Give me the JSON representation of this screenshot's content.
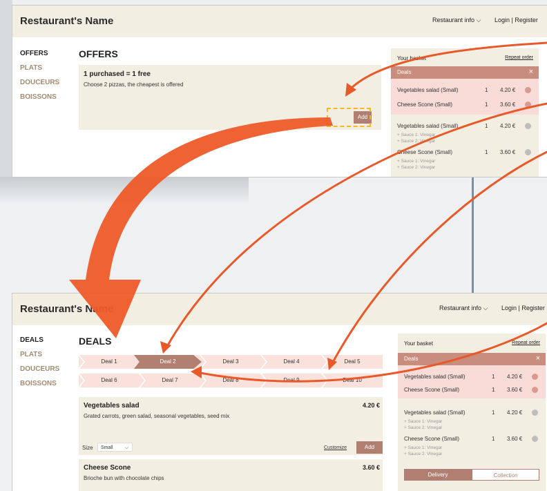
{
  "screens": {
    "offers": {
      "logo": "Restaurant's Name",
      "restaurant_info": "Restaurant info",
      "login": "Login | Register",
      "sidebar": [
        "OFFERS",
        "PLATS",
        "DOUCEURS",
        "BOISSONS"
      ],
      "page_title": "OFFERS",
      "offer": {
        "title": "1 purchased = 1 free",
        "desc": "Choose 2 pizzas, the cheapest is offered",
        "add_label": "Add"
      },
      "basket": {
        "title": "Your basket",
        "repeat": "Repeat order",
        "deals_label": "Deals",
        "deal_items": [
          {
            "name": "Vegetables salad (Small)",
            "qty": "1",
            "price": "4.20 €"
          },
          {
            "name": "Cheese Scone (Small)",
            "qty": "1",
            "price": "3.60 €"
          }
        ],
        "items": [
          {
            "name": "Vegetables salad (Small)",
            "qty": "1",
            "price": "4.20 €",
            "sauces": [
              "+ Sauce 1: Vinegar",
              "+ Sauce 2: Vinegar"
            ]
          },
          {
            "name": "Cheese Scone (Small)",
            "qty": "1",
            "price": "3.60 €",
            "sauces": [
              "+ Sauce 1: Vinegar",
              "+ Sauce 2: Vinegar"
            ]
          }
        ]
      }
    },
    "deals": {
      "logo": "Restaurant's Name",
      "restaurant_info": "Restaurant info",
      "login": "Login | Register",
      "sidebar": [
        "DEALS",
        "PLATS",
        "DOUCEURS",
        "BOISSONS"
      ],
      "page_title": "DEALS",
      "tabs_row1": [
        "Deal 1",
        "Deal 2",
        "Deal 3",
        "Deal 4",
        "Deal 5"
      ],
      "tabs_row2": [
        "Deal 6",
        "Deal 7",
        "Deal 8",
        "Deal 9",
        "Deal 10"
      ],
      "products": [
        {
          "name": "Vegetables salad",
          "price": "4.20 €",
          "desc": "Grated carrots, green salad, seasonal vegetables, seed mix",
          "size_label": "Size",
          "size_value": "Small",
          "customize": "Customize",
          "add": "Add"
        },
        {
          "name": "Cheese Scone",
          "price": "3.60 €",
          "desc": "Brioche bun with chocolate chips"
        }
      ],
      "basket": {
        "title": "Your basket",
        "repeat": "Repeat order",
        "deals_label": "Deals",
        "deal_items": [
          {
            "name": "Vegetables salad (Small)",
            "qty": "1",
            "price": "4.20 €"
          },
          {
            "name": "Cheese Scone (Small)",
            "qty": "1",
            "price": "3.60 €"
          }
        ],
        "items": [
          {
            "name": "Vegetables salad (Small)",
            "qty": "1",
            "price": "4.20 €",
            "sauces": [
              "+ Sauce 1: Vinegar",
              "+ Sauce 2: Vinegar"
            ]
          },
          {
            "name": "Cheese Scone (Small)",
            "qty": "1",
            "price": "3.60 €",
            "sauces": [
              "+ Sauce 1: Vinegar",
              "+ Sauce 2: Vinegar"
            ]
          }
        ],
        "delivery": "Delivery",
        "collection": "Collection"
      }
    }
  },
  "colors": {
    "header_bg": "#f3eee2",
    "accent": "#b07f72",
    "deals_bar": "#c98d7e",
    "pink": "#f9dcd7",
    "arrow": "#e8592a",
    "dash": "#f6b81f"
  },
  "icons": {
    "chevron": "chevron-down-icon",
    "close": "close-icon",
    "remove": "minus-circle-icon"
  }
}
